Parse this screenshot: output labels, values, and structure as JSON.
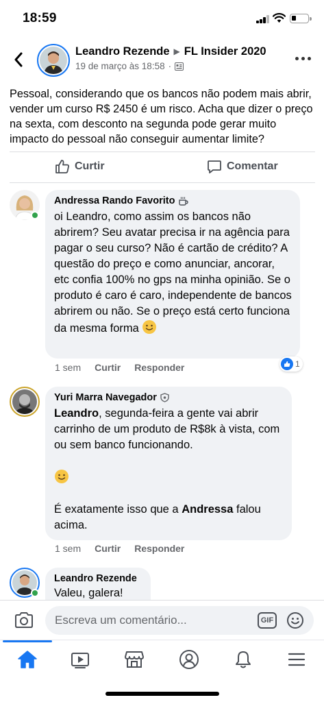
{
  "status_bar": {
    "time": "18:59"
  },
  "post": {
    "author": "Leandro Rezende",
    "group": "FL Insider 2020",
    "timestamp": "19 de março às 18:58",
    "text": "Pessoal, considerando que os bancos não podem mais abrir, vender um curso R$ 2450 é um risco. Acha que dizer o preço na sexta, com desconto na segunda pode gerar muito impacto do pessoal não conseguir aumentar limite?",
    "like_label": "Curtir",
    "comment_label": "Comentar"
  },
  "comments": [
    {
      "author": "Andressa Rando Favorito",
      "text": "oi Leandro, como assim os bancos não abrirem? Seu avatar precisa ir na agência para pagar o seu curso? Não é cartão de crédito? A questão do preço e como anunciar, ancorar, etc confia 100% no gps na minha opinião. Se o produto é caro é caro, independente de bancos abrirem ou não. Se o preço está certo funciona da mesma forma",
      "time": "1 sem",
      "like_label": "Curtir",
      "reply_label": "Responder",
      "reaction_count": "1"
    },
    {
      "author": "Yuri Marra Navegador",
      "mention": "Leandro",
      "text_line1": ", segunda-feira a gente vai abrir carrinho de um produto de R$8k à vista, com ou sem banco funcionando.",
      "text_line2_prefix": "É exatamente isso que a ",
      "mention2": "Andressa",
      "text_line2_suffix": " falou acima.",
      "time": "1 sem",
      "like_label": "Curtir",
      "reply_label": "Responder"
    },
    {
      "author": "Leandro Rezende",
      "text": "Valeu, galera!"
    }
  ],
  "composer": {
    "placeholder": "Escreva um comentário...",
    "gif_label": "GIF"
  },
  "colors": {
    "accent": "#1877f2",
    "bubble": "#f0f2f5",
    "online": "#31a24c"
  }
}
